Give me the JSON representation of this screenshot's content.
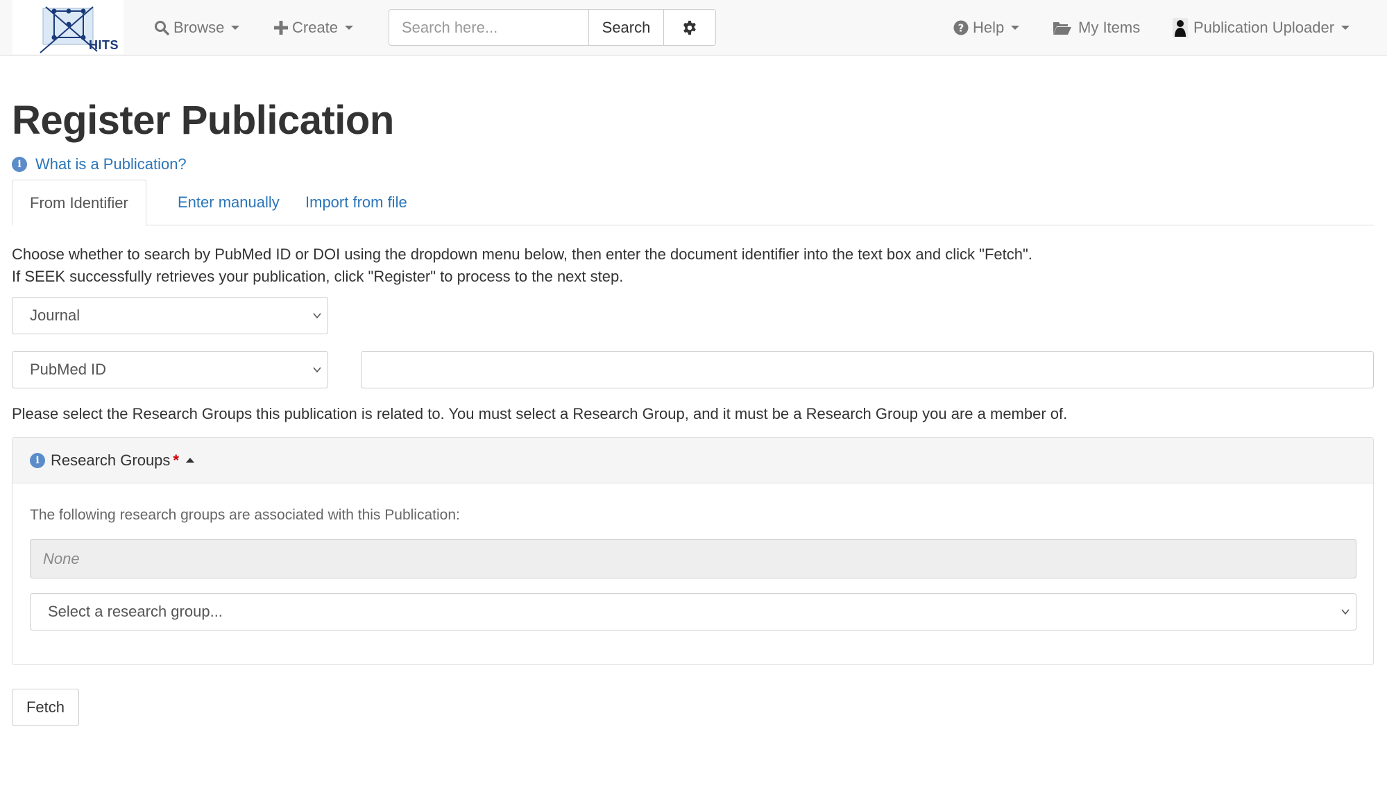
{
  "navbar": {
    "logo_text": "HITS",
    "browse_label": "Browse",
    "create_label": "Create",
    "search": {
      "placeholder": "Search here...",
      "value": "",
      "button_label": "Search"
    },
    "help_label": "Help",
    "my_items_label": "My Items",
    "user_label": "Publication Uploader"
  },
  "page": {
    "title": "Register Publication",
    "help_link": "What is a Publication?",
    "tabs": [
      {
        "label": "From Identifier",
        "active": true
      },
      {
        "label": "Enter manually",
        "active": false
      },
      {
        "label": "Import from file",
        "active": false
      }
    ],
    "instructions": [
      "Choose whether to search by PubMed ID or DOI using the dropdown menu below, then enter the document identifier into the text box and click \"Fetch\".",
      "If SEEK successfully retrieves your publication, click \"Register\" to process to the next step."
    ],
    "publication_type_select": "Journal",
    "identifier_type_select": "PubMed ID",
    "identifier_value": "",
    "research_groups_note": "Please select the Research Groups this publication is related to. You must select a Research Group, and it must be a Research Group you are a member of.",
    "research_groups_panel": {
      "heading": "Research Groups",
      "required_marker": "*",
      "associated_text": "The following research groups are associated with this Publication:",
      "associated_value": "None",
      "select_placeholder": "Select a research group..."
    },
    "fetch_button": "Fetch"
  },
  "colors": {
    "link": "#2a75b8",
    "navbar_bg": "#f8f8f8",
    "required": "#cc0000"
  },
  "icons": [
    "logo-icon",
    "search-icon",
    "plus-icon",
    "gear-icon",
    "question-circle-icon",
    "folder-open-icon",
    "user-icon",
    "info-icon",
    "chevron-down-icon",
    "caret-up-icon"
  ]
}
